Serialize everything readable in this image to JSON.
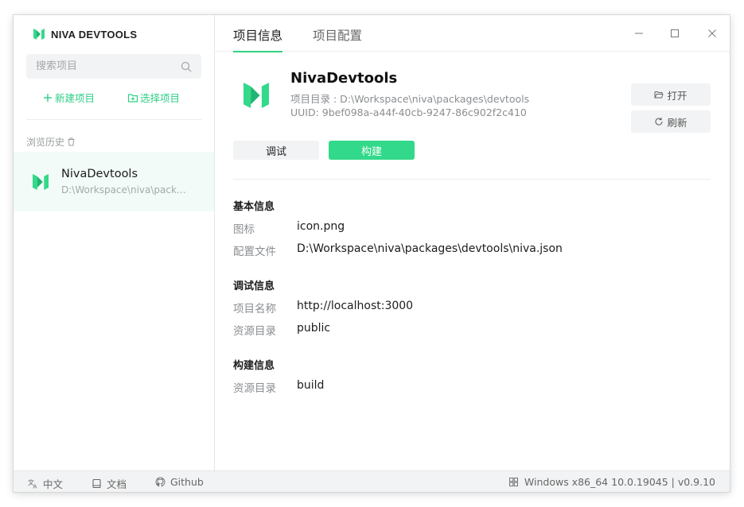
{
  "app": {
    "brand": "NIVA DEVTOOLS"
  },
  "sidebar": {
    "search_placeholder": "搜索项目",
    "new_project": "新建项目",
    "select_project": "选择项目",
    "history_label": "浏览历史",
    "history": [
      {
        "name": "NivaDevtools",
        "path": "D:\\Workspace\\niva\\packages\\devtools"
      }
    ]
  },
  "tabs": [
    {
      "label": "项目信息",
      "active": true
    },
    {
      "label": "项目配置",
      "active": false
    }
  ],
  "project": {
    "name": "NivaDevtools",
    "dir_line": "项目目录 : D:\\Workspace\\niva\\packages\\devtools",
    "uuid_line": "UUID: 9bef098a-a44f-40cb-9247-86c902f2c410",
    "open_label": "打开",
    "refresh_label": "刷新",
    "debug_label": "调试",
    "build_label": "构建"
  },
  "sections": {
    "basic": {
      "title": "基本信息",
      "fields": [
        {
          "label": "图标",
          "value": "icon.png"
        },
        {
          "label": "配置文件",
          "value": "D:\\Workspace\\niva\\packages\\devtools\\niva.json"
        }
      ]
    },
    "debug": {
      "title": "调试信息",
      "fields": [
        {
          "label": "项目名称",
          "value": "http://localhost:3000"
        },
        {
          "label": "资源目录",
          "value": "public"
        }
      ]
    },
    "build": {
      "title": "构建信息",
      "fields": [
        {
          "label": "资源目录",
          "value": "build"
        }
      ]
    }
  },
  "footer": {
    "lang": "中文",
    "docs": "文档",
    "github": "Github",
    "system": "Windows x86_64 10.0.19045 | v0.9.10"
  },
  "colors": {
    "accent": "#33d98a",
    "accent_text": "#2fcf86"
  }
}
